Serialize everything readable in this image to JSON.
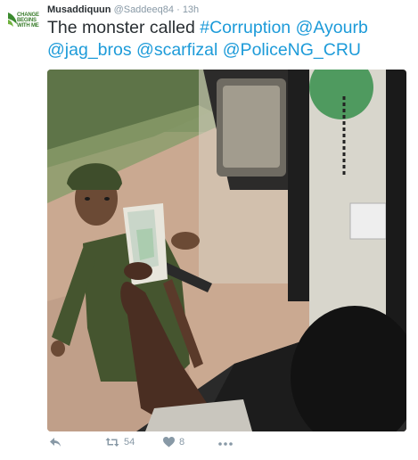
{
  "tweet": {
    "avatar_brand": [
      "CHANGE",
      "BEGINS",
      "WITH ME"
    ],
    "author_name": "Musaddiquun",
    "author_handle": "@Saddeeq84",
    "separator": "·",
    "timestamp": "13h",
    "text_plain": "The monster called ",
    "links": [
      "#Corruption",
      "@Ayourb",
      "@jag_bros",
      "@scarfizal",
      "@PoliceNG_CRU"
    ],
    "actions": {
      "reply_icon": "reply-icon",
      "retweet_icon": "retweet-icon",
      "retweet_count": "54",
      "like_icon": "heart-icon",
      "like_count": "8",
      "more_icon": "more-icon"
    }
  }
}
